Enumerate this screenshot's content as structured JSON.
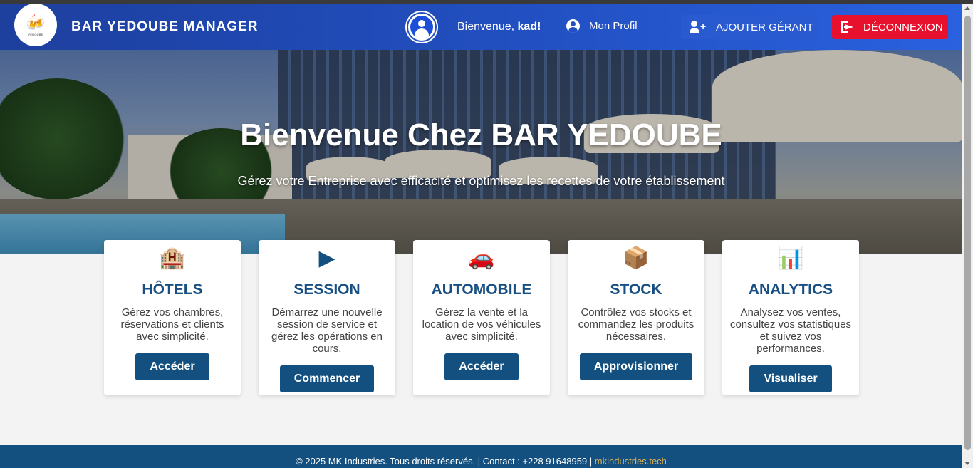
{
  "header": {
    "logo_text": "YEDOUBE",
    "brand": "BAR YEDOUBE MANAGER",
    "welcome_prefix": "Bienvenue,",
    "username": "kad!",
    "profile_label": "Mon Profil",
    "add_manager_label": "AJOUTER GÉRANT",
    "logout_label": "DÉCONNEXION",
    "logout_color": "#e8112d",
    "navbar_color": "#2250c2"
  },
  "hero": {
    "title": "Bienvenue Chez BAR YEDOUBE",
    "subtitle": "Gérez votre Entreprise avec efficacité et optimisez les recettes de votre établissement"
  },
  "cards": [
    {
      "icon": "🏨",
      "icon_name": "hotel-icon",
      "title": "HÔTELS",
      "description": "Gérez vos chambres, réservations et clients avec simplicité.",
      "button": "Accéder"
    },
    {
      "icon": "▶",
      "icon_name": "play-icon",
      "title": "SESSION",
      "description": "Démarrez une nouvelle session de service et gérez les opérations en cours.",
      "button": "Commencer"
    },
    {
      "icon": "🚗",
      "icon_name": "car-icon",
      "title": "AUTOMOBILE",
      "description": "Gérez la vente et la location de vos véhicules avec simplicité.",
      "button": "Accéder"
    },
    {
      "icon": "📦",
      "icon_name": "box-icon",
      "title": "STOCK",
      "description": "Contrôlez vos stocks et commandez les produits nécessaires.",
      "button": "Approvisionner"
    },
    {
      "icon": "📊",
      "icon_name": "chart-icon",
      "title": "ANALYTICS",
      "description": "Analysez vos ventes, consultez vos statistiques et suivez vos performances.",
      "button": "Visualiser"
    }
  ],
  "footer": {
    "text": "© 2025 MK Industries. Tous droits réservés. | Contact : +228 91648959 |",
    "link": "mkindustries.tech",
    "link_color": "#e0b257",
    "background": "#13507f"
  }
}
